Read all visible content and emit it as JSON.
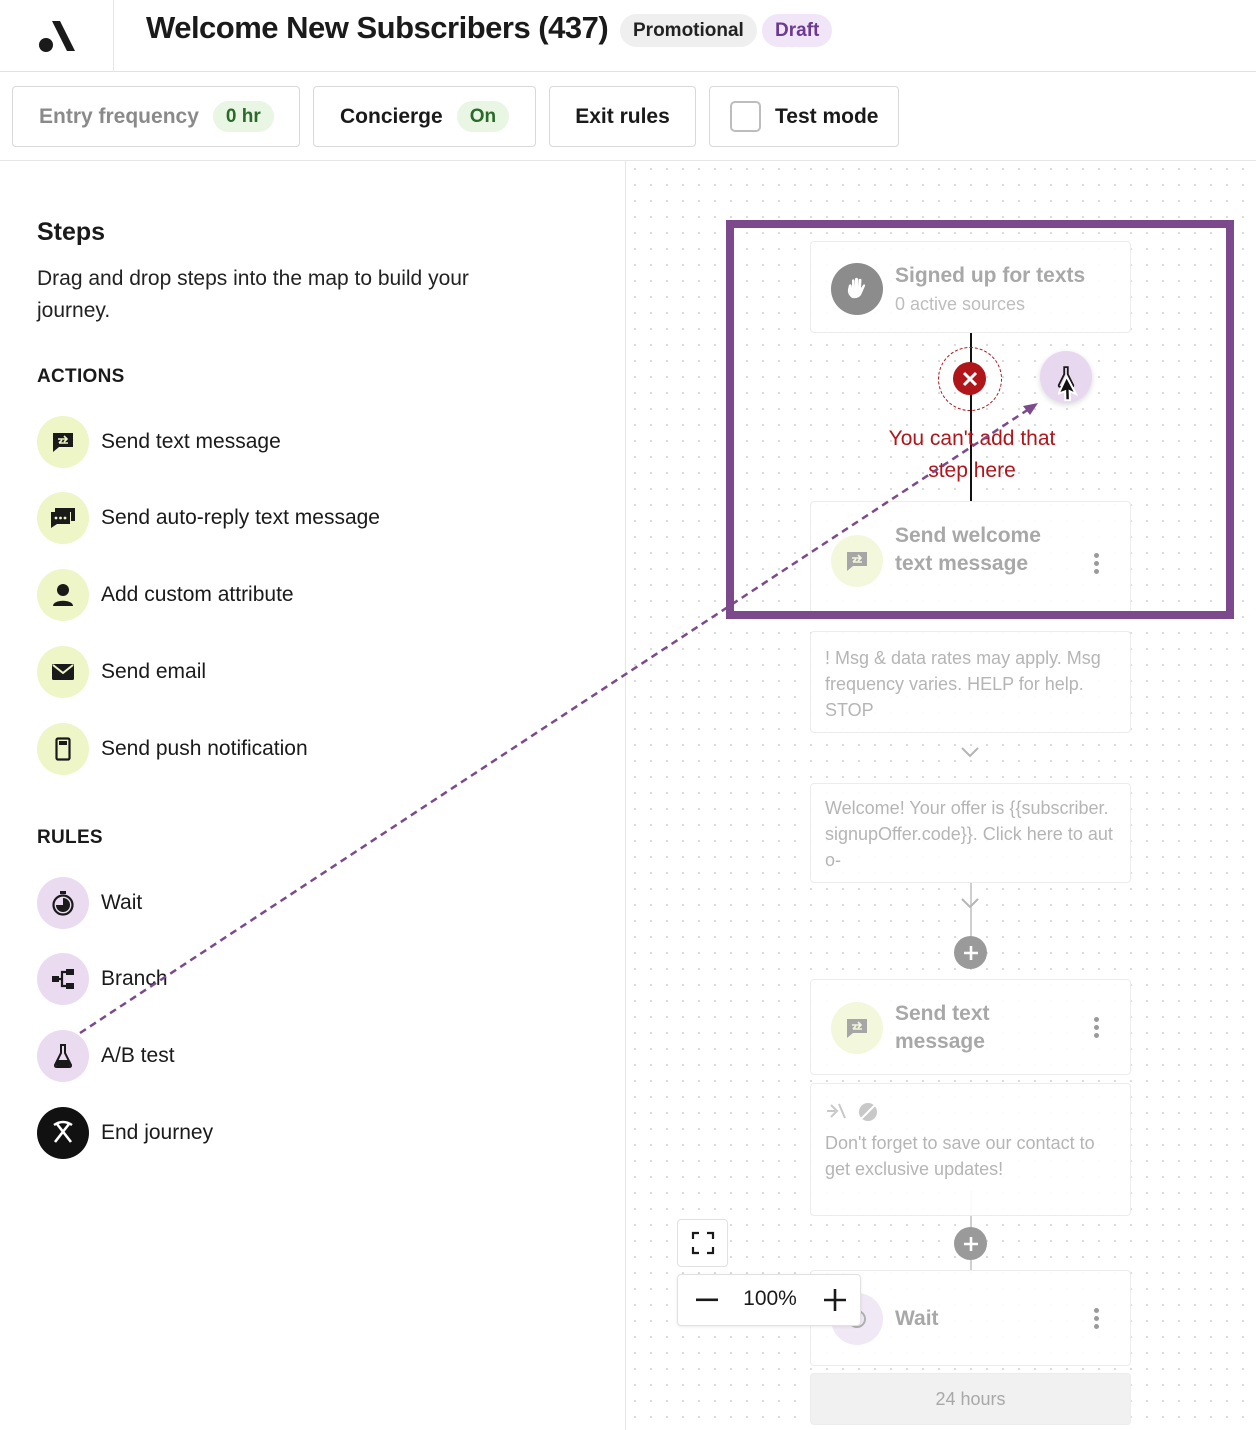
{
  "header": {
    "title": "Welcome New Subscribers (437)",
    "badges": {
      "type": "Promotional",
      "status": "Draft"
    }
  },
  "toolbar": {
    "entry_frequency": {
      "label": "Entry frequency",
      "value": "0 hr"
    },
    "concierge": {
      "label": "Concierge",
      "value": "On"
    },
    "exit_rules": {
      "label": "Exit rules"
    },
    "test_mode": {
      "label": "Test mode",
      "checked": false
    }
  },
  "steps_panel": {
    "title": "Steps",
    "description": "Drag and drop steps into the map to build your journey.",
    "actions_heading": "ACTIONS",
    "actions": [
      {
        "label": "Send text message",
        "icon": "text-message-icon"
      },
      {
        "label": "Send auto-reply text message",
        "icon": "auto-reply-icon"
      },
      {
        "label": "Add custom attribute",
        "icon": "person-icon"
      },
      {
        "label": "Send email",
        "icon": "envelope-icon"
      },
      {
        "label": "Send push notification",
        "icon": "phone-icon"
      }
    ],
    "rules_heading": "RULES",
    "rules": [
      {
        "label": "Wait",
        "icon": "timer-icon"
      },
      {
        "label": "Branch",
        "icon": "branch-icon"
      },
      {
        "label": "A/B test",
        "icon": "flask-icon"
      },
      {
        "label": "End journey",
        "icon": "pickaxes-icon"
      }
    ]
  },
  "canvas": {
    "trigger": {
      "title": "Signed up for texts",
      "subtitle": "0 active sources"
    },
    "error_message": "You can't add that step here",
    "step1": {
      "title": "Send welcome text message"
    },
    "message1_preview": "! Msg & data rates may apply. Msg frequency varies. HELP for help. STOP",
    "message2_preview": "Welcome! Your offer is {{subscriber.signupOffer.code}}. Click here to auto-",
    "step2": {
      "title": "Send text message"
    },
    "message3_preview": "Don't forget to save our contact to get exclusive updates!",
    "wait_step": {
      "title": "Wait",
      "duration": "24 hours"
    },
    "zoom": "100%"
  },
  "colors": {
    "action_icon_bg": "#eef6c7",
    "rule_icon_bg": "#eadbf1",
    "highlight": "#7c4a8c",
    "error": "#b0151a",
    "badge_green": "#e9f6e3"
  }
}
